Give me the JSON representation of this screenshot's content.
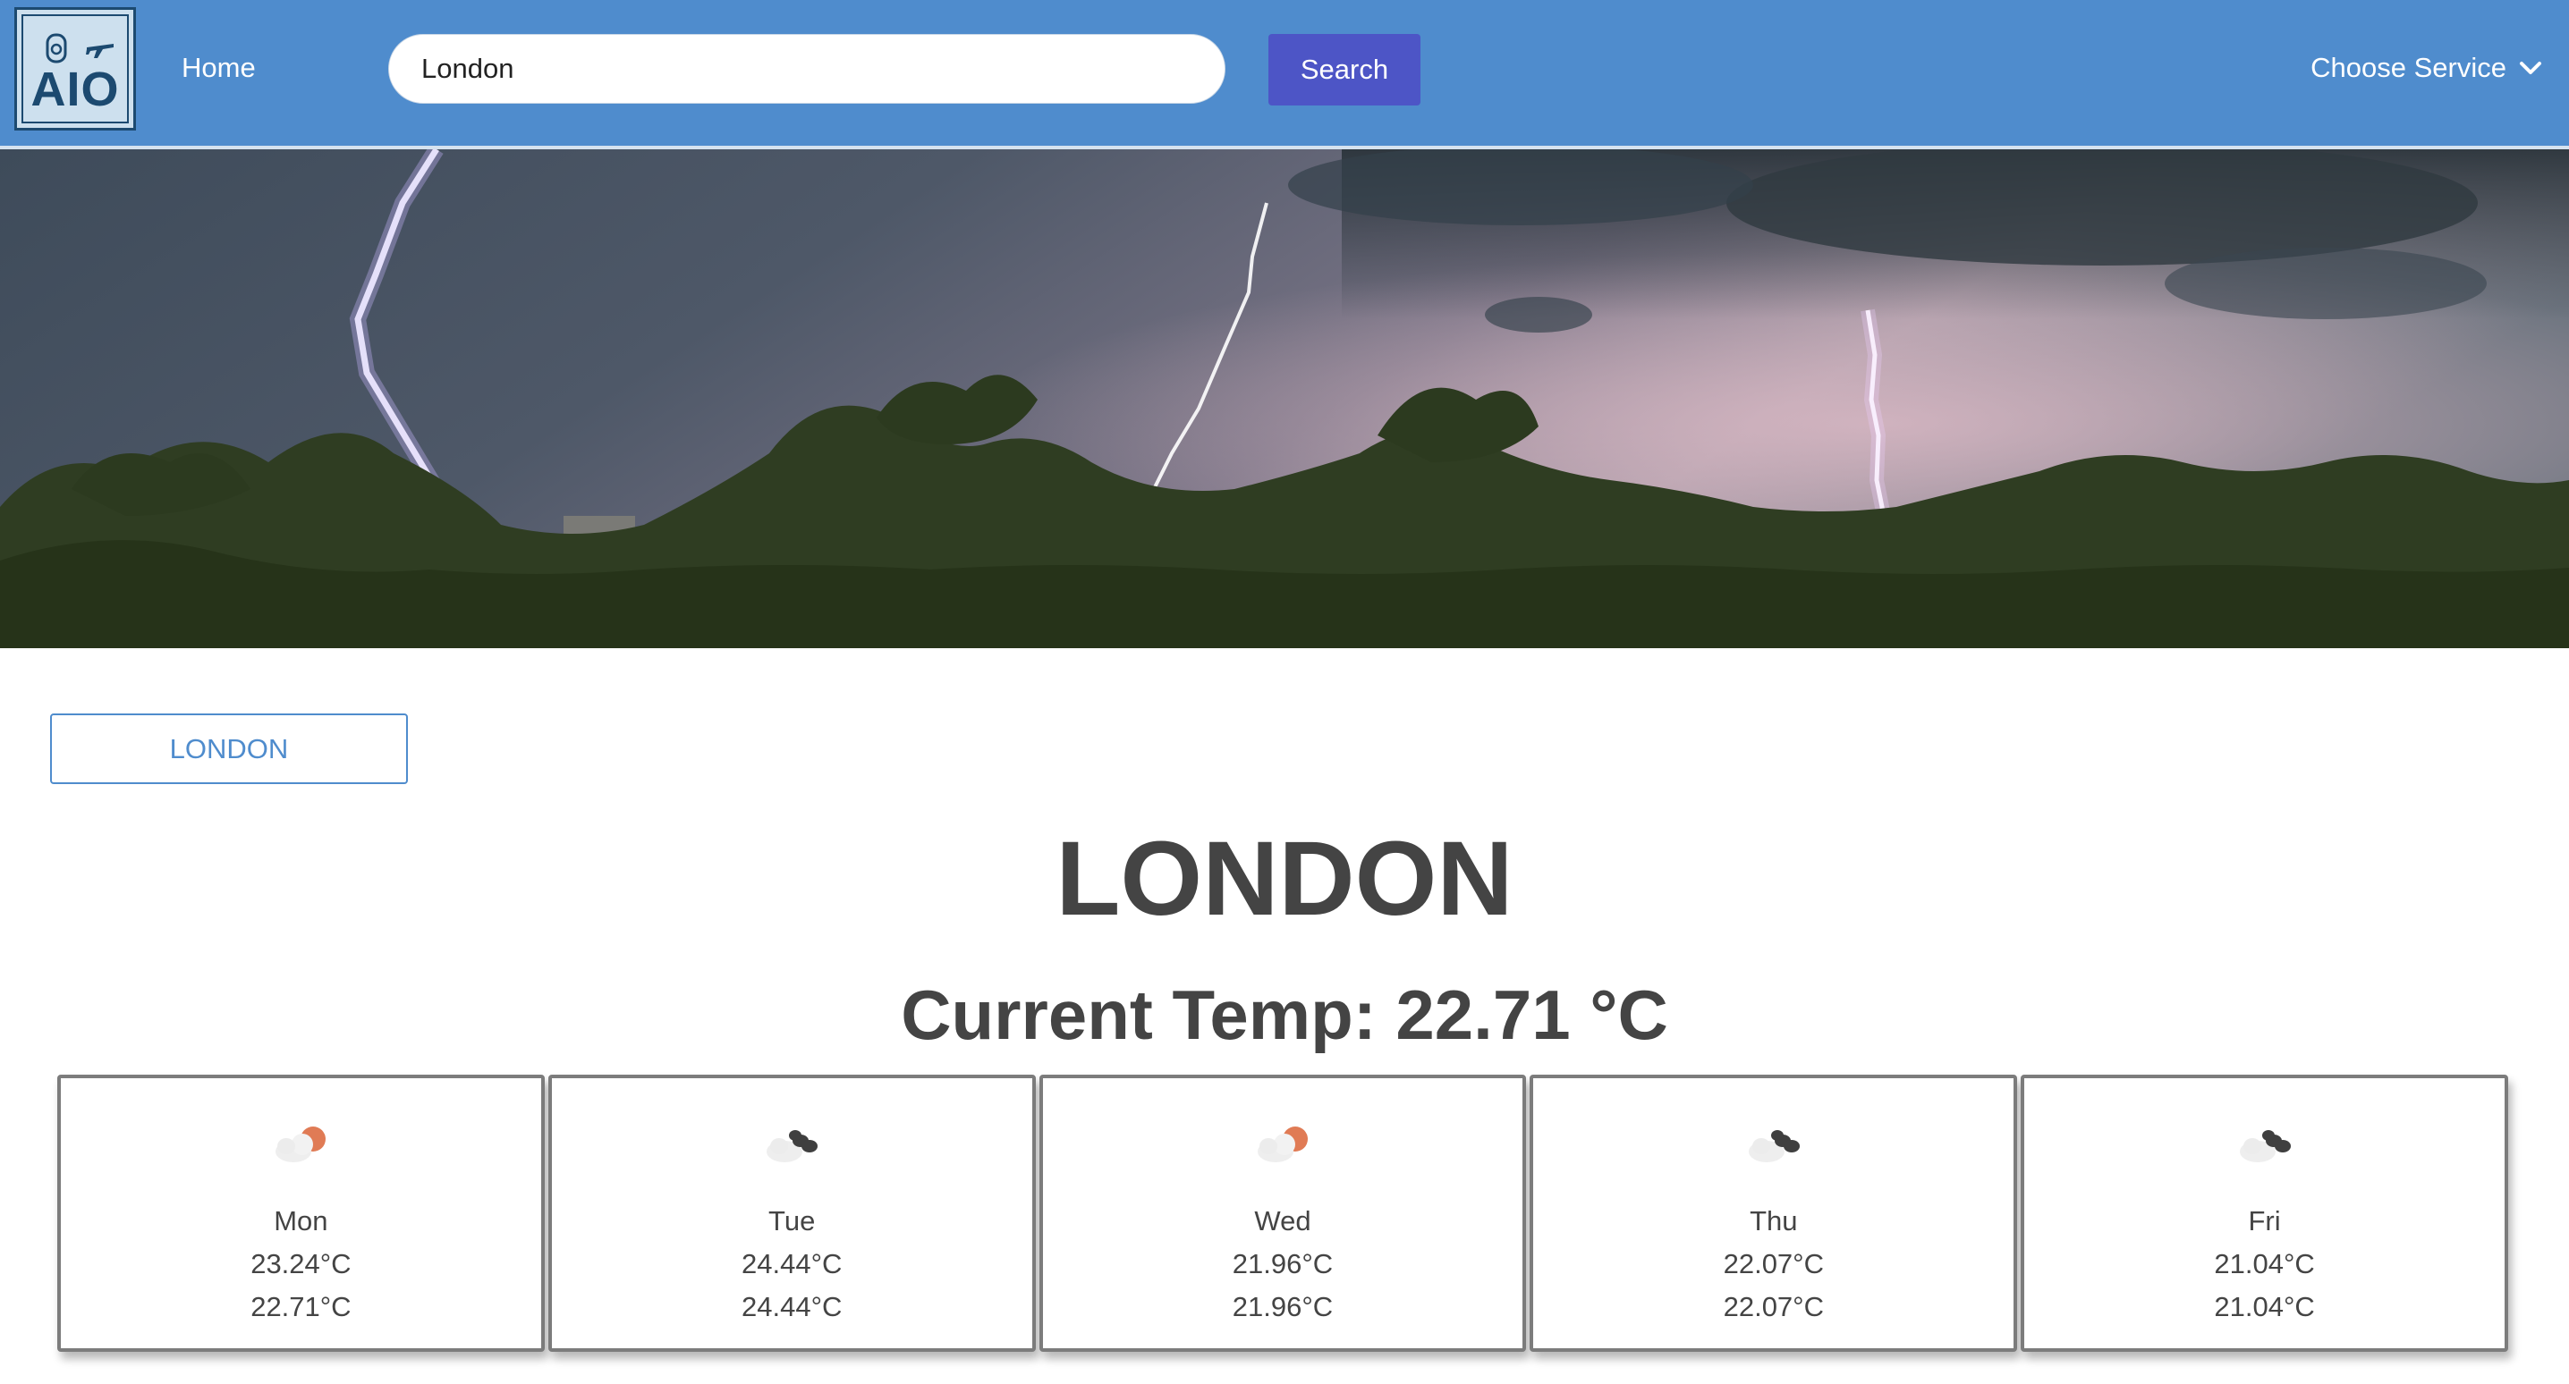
{
  "header": {
    "logo_text": "AIO",
    "home_label": "Home",
    "search": {
      "value": "London",
      "placeholder": ""
    },
    "search_button_label": "Search",
    "service_dropdown_label": "Choose Service"
  },
  "city_chip_label": "LONDON",
  "city_title": "LONDON",
  "current_temp": "Current Temp: 22.71 °C",
  "colors": {
    "navbar": "#4f8ccd",
    "search_button": "#4d55c6",
    "text": "#444444",
    "sun_accent": "#e07b55"
  },
  "forecast": [
    {
      "day": "Mon",
      "temp_hi": "23.24°C",
      "temp_lo": "22.71°C",
      "icon": "cloud-sun-icon"
    },
    {
      "day": "Tue",
      "temp_hi": "24.44°C",
      "temp_lo": "24.44°C",
      "icon": "broken-clouds-icon"
    },
    {
      "day": "Wed",
      "temp_hi": "21.96°C",
      "temp_lo": "21.96°C",
      "icon": "cloud-sun-icon"
    },
    {
      "day": "Thu",
      "temp_hi": "22.07°C",
      "temp_lo": "22.07°C",
      "icon": "broken-clouds-icon"
    },
    {
      "day": "Fri",
      "temp_hi": "21.04°C",
      "temp_lo": "21.04°C",
      "icon": "broken-clouds-icon"
    }
  ]
}
